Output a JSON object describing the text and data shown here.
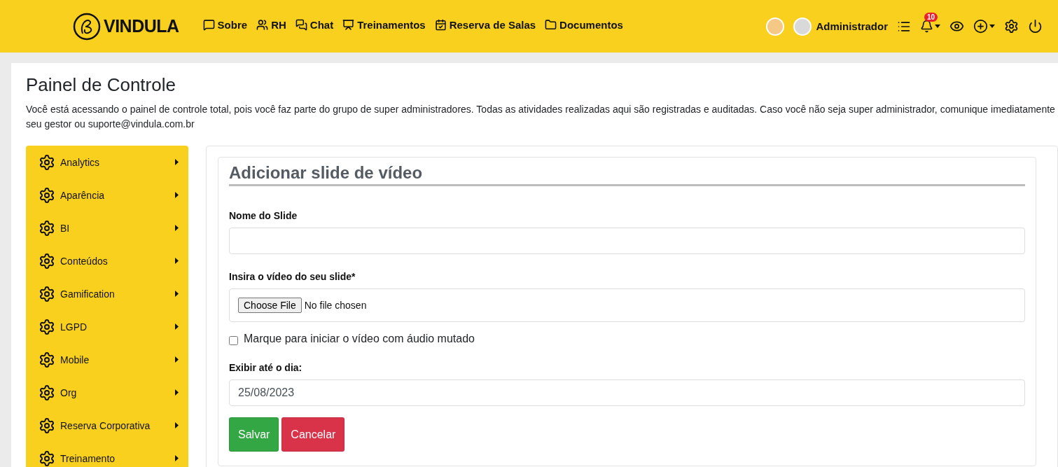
{
  "header": {
    "logo": "VINDULA",
    "nav": [
      {
        "label": "Sobre",
        "kind": "about"
      },
      {
        "label": "RH",
        "kind": "people"
      },
      {
        "label": "Chat",
        "kind": "chat"
      },
      {
        "label": "Treinamentos",
        "kind": "training"
      },
      {
        "label": "Reserva de Salas",
        "kind": "calendar"
      },
      {
        "label": "Documentos",
        "kind": "folder"
      }
    ],
    "user": "Administrador",
    "notifications": "10"
  },
  "page": {
    "title": "Painel de Controle",
    "notice": "Você está acessando o painel de controle total, pois você faz parte do grupo de super administradores. Todas as atividades realizadas aqui são registradas e auditadas. Caso você não seja super administrador, comunique imediatamente seu gestor ou suporte@vindula.com.br"
  },
  "sidebar": {
    "items": [
      {
        "label": "Analytics"
      },
      {
        "label": "Aparência"
      },
      {
        "label": "BI"
      },
      {
        "label": "Conteúdos"
      },
      {
        "label": "Gamification"
      },
      {
        "label": "LGPD"
      },
      {
        "label": "Mobile"
      },
      {
        "label": "Org"
      },
      {
        "label": "Reserva Corporativa"
      },
      {
        "label": "Treinamento"
      }
    ]
  },
  "form": {
    "title": "Adicionar slide de vídeo",
    "name_label": "Nome do Slide",
    "video_label": "Insira o vídeo do seu slide*",
    "file_button": "Choose File",
    "file_status": "No file chosen",
    "mute": {
      "label": "Marque para iniciar o vídeo com áudio mutado",
      "checked": false
    },
    "date_label": "Exibir até o dia:",
    "date_value": "25/08/2023",
    "buttons": [
      {
        "label": "Salvar",
        "kind": "save"
      },
      {
        "label": "Cancelar",
        "kind": "cancel"
      }
    ]
  }
}
